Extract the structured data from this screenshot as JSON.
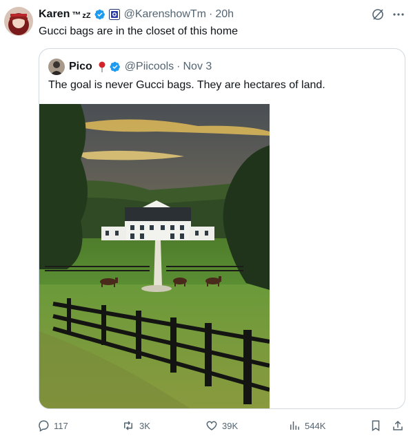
{
  "tweet": {
    "author_name": "Karen",
    "author_suffix": "™",
    "zz": "zZ",
    "handle": "@KarenshowTm",
    "separator": "·",
    "time": "20h",
    "text": "Gucci bags are in the closet of this home"
  },
  "quote": {
    "author_name": "Pico",
    "handle": "@Piicools",
    "separator": "·",
    "time": "Nov 3",
    "text": "The goal is never Gucci bags. They are hectares of land."
  },
  "actions": {
    "replies": "117",
    "reposts": "3K",
    "likes": "39K",
    "views": "544K"
  },
  "icons": {
    "verified": "verified-badge-icon",
    "affiliate": "affiliate-badge-icon",
    "grok": "grok-icon",
    "more": "more-icon",
    "reply": "reply-icon",
    "repost": "repost-icon",
    "like": "heart-icon",
    "views": "views-icon",
    "bookmark": "bookmark-icon",
    "share": "share-icon"
  },
  "colors": {
    "verified": "#1d9bf0",
    "secondary_text": "#536471",
    "border": "#cfd9de"
  }
}
